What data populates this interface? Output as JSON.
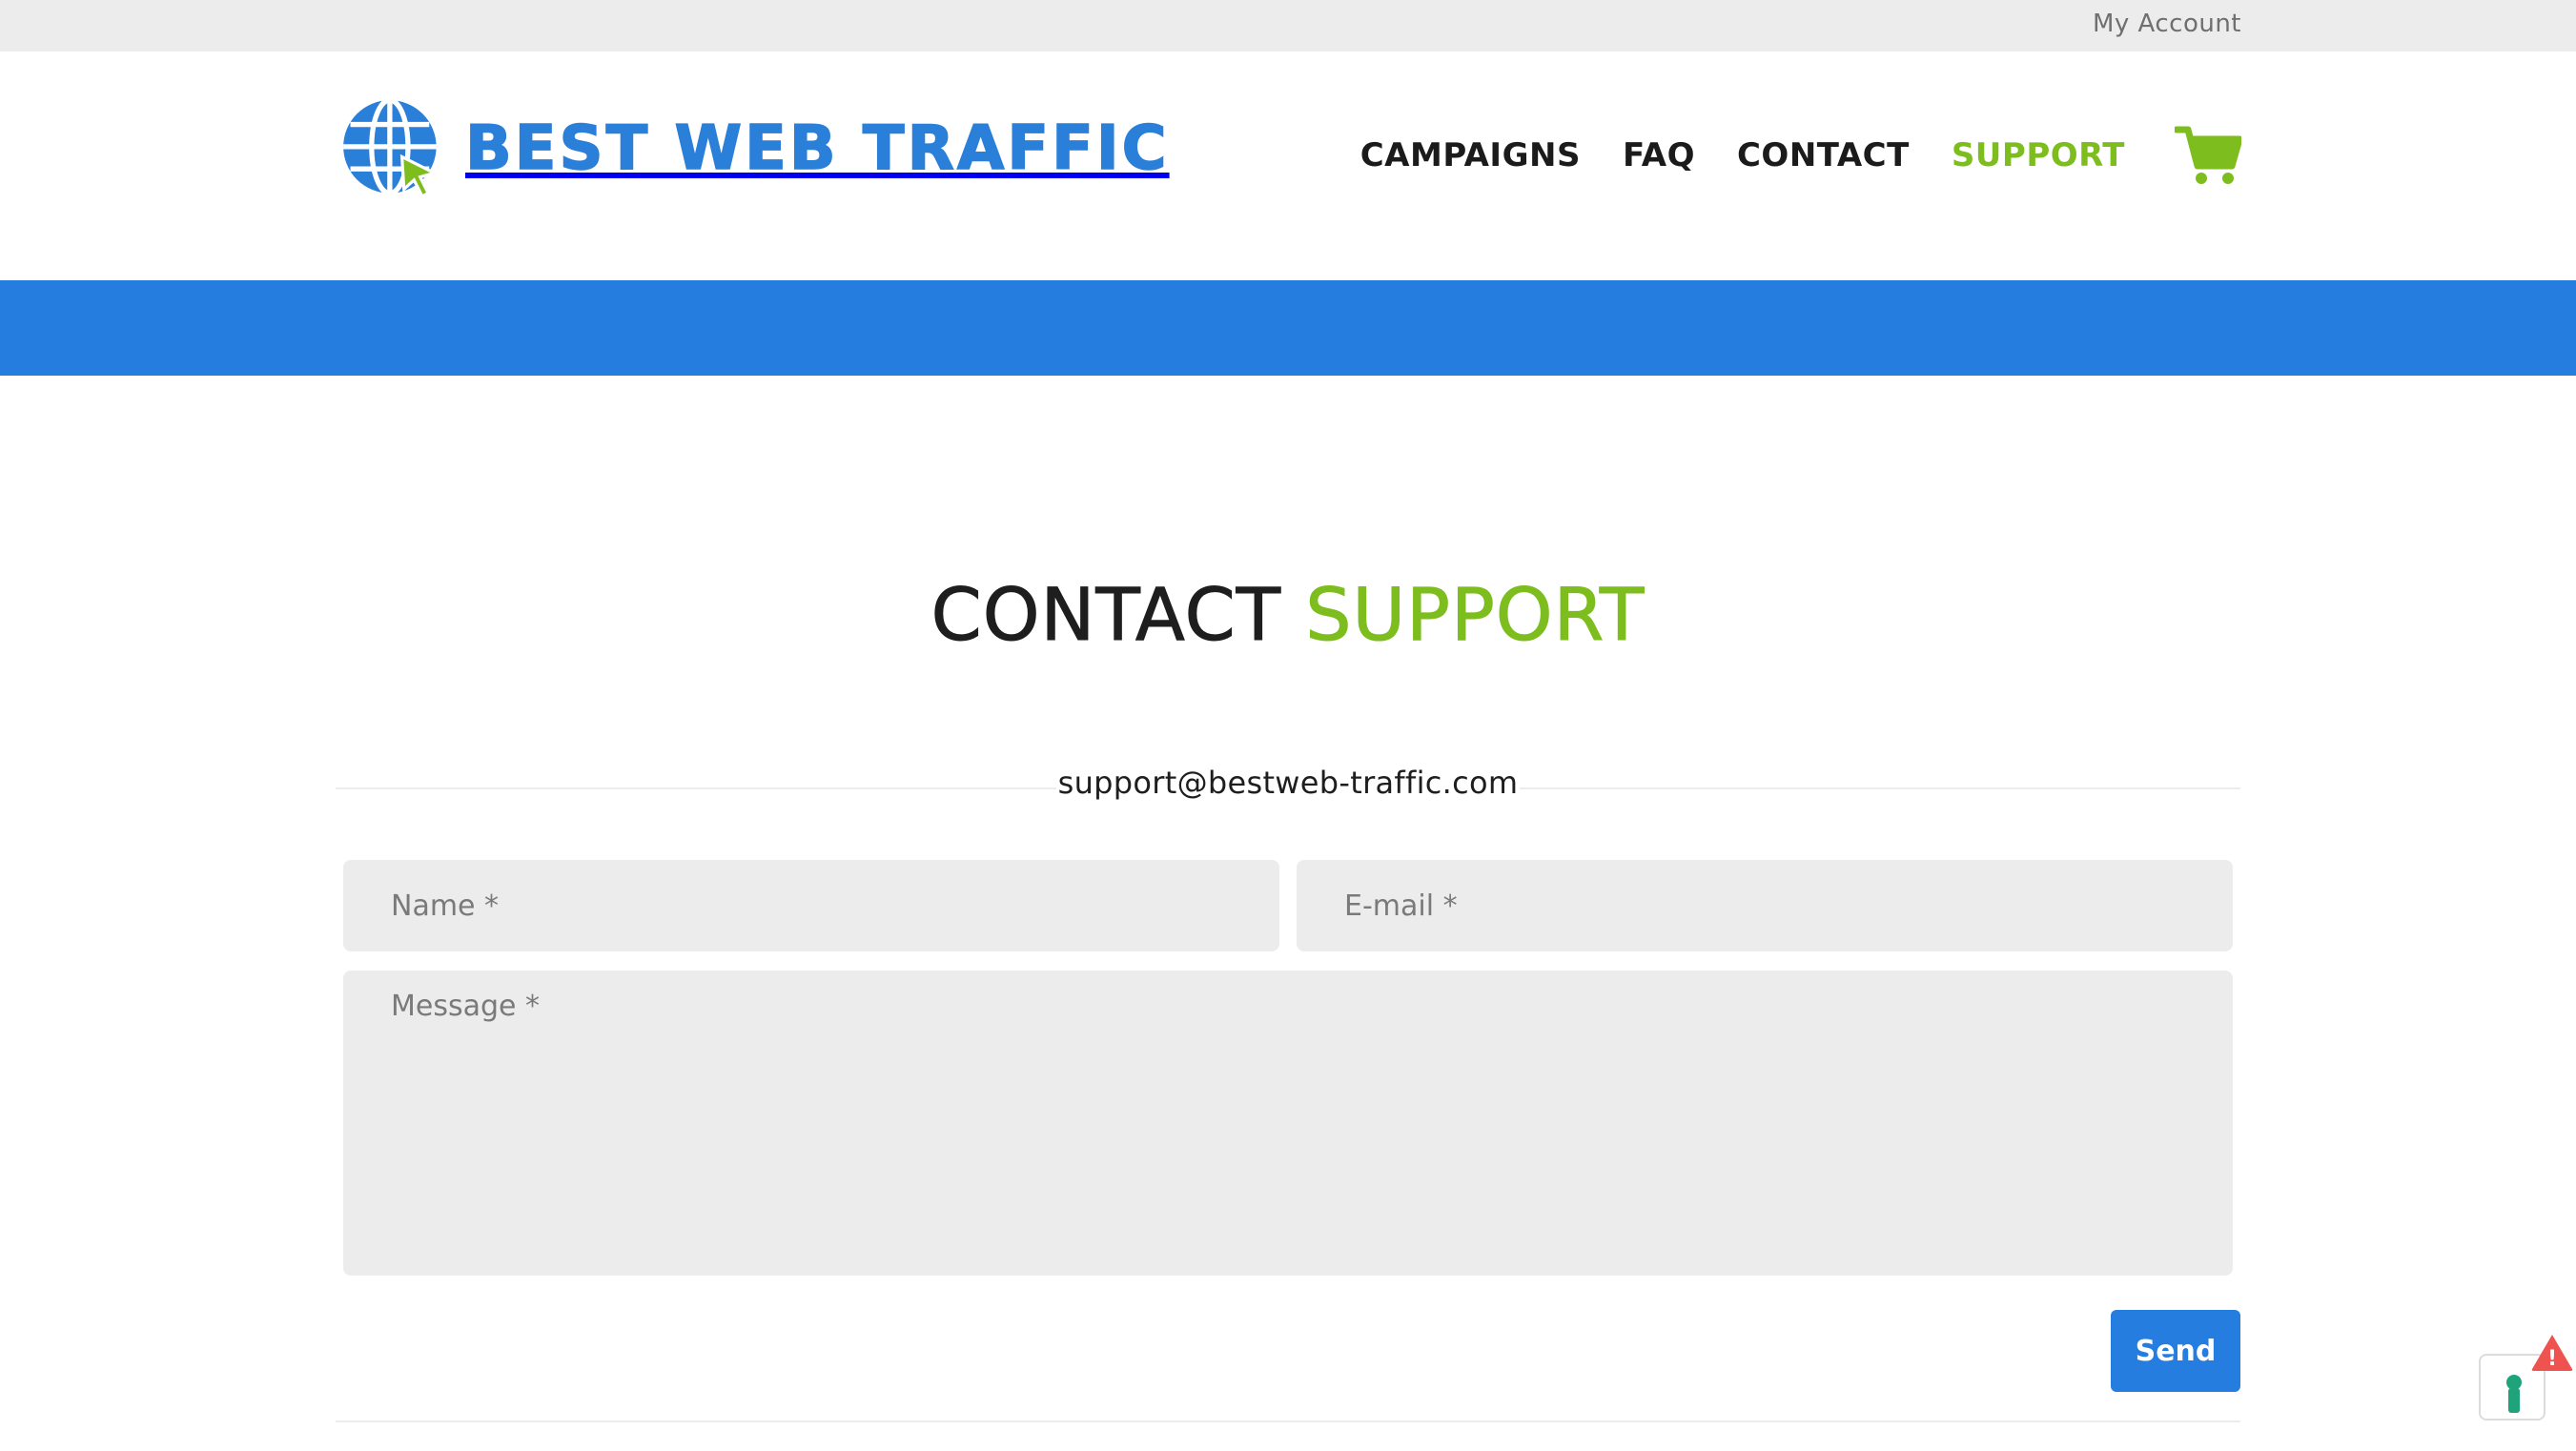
{
  "topbar": {
    "account_label": "My Account"
  },
  "header": {
    "brand": "BEST WEB TRAFFIC",
    "brand_color": "#2a7fd9",
    "nav": [
      {
        "label": "CAMPAIGNS",
        "active": false
      },
      {
        "label": "FAQ",
        "active": false
      },
      {
        "label": "CONTACT",
        "active": false
      },
      {
        "label": "SUPPORT",
        "active": true
      }
    ],
    "cart_icon": "shopping-cart-icon",
    "accent_color": "#7dbd1e"
  },
  "banner": {
    "color": "#267de0"
  },
  "main": {
    "title_part1": "CONTACT",
    "title_part2": "SUPPORT",
    "support_email": "support@bestweb-traffic.com",
    "form": {
      "name_placeholder": "Name *",
      "email_placeholder": "E-mail *",
      "message_placeholder": "Message *",
      "send_label": "Send"
    }
  },
  "widget": {
    "icon": "keyhole-icon",
    "alert_icon": "warning-alert-icon",
    "alert_glyph": "!"
  }
}
